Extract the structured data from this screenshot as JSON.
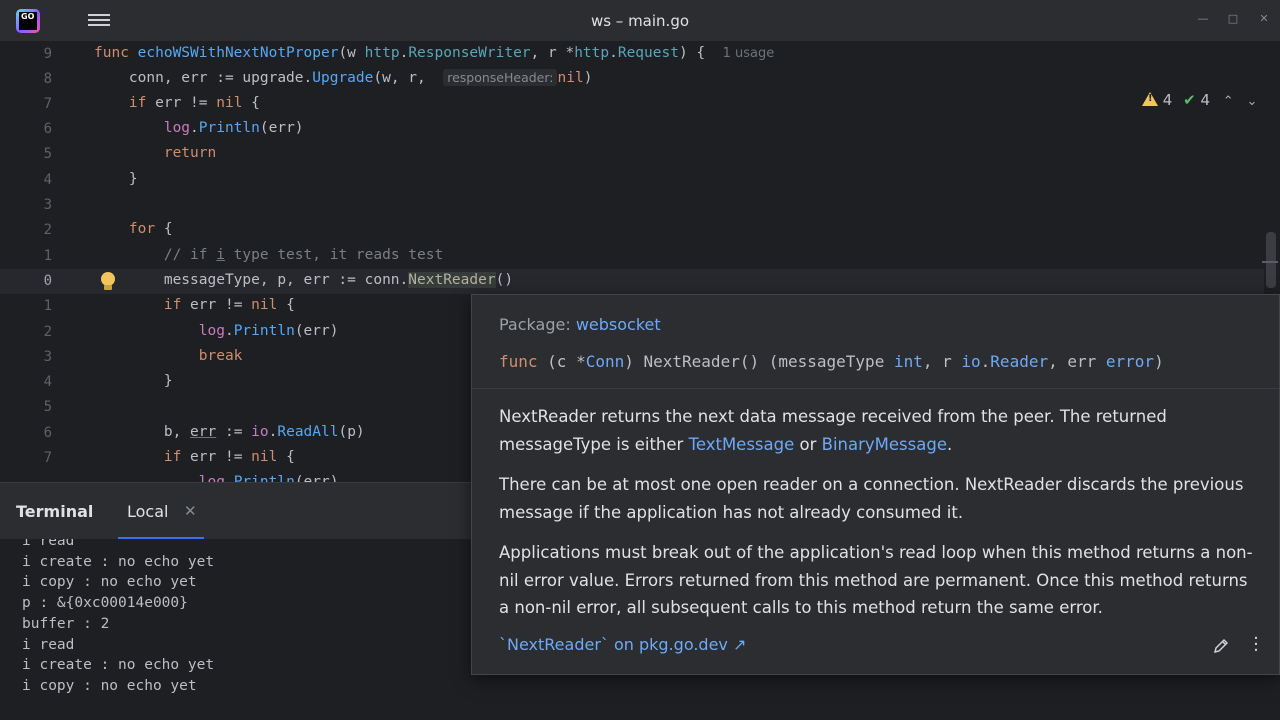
{
  "window": {
    "title": "ws – main.go",
    "logo_text": "GO"
  },
  "editor": {
    "gutter": [
      "9",
      "8",
      "7",
      "6",
      "5",
      "4",
      "3",
      "2",
      "1",
      "0",
      "1",
      "2",
      "3",
      "4",
      "5",
      "6",
      "7"
    ],
    "usage_hint": "1 usage",
    "param_hint": "responseHeader:",
    "inspections": {
      "warnings": "4",
      "weak_warnings": "4"
    }
  },
  "terminal": {
    "title": "Terminal",
    "tab_label": "Local",
    "lines": [
      "i read",
      "i create : no echo yet",
      "i copy : no echo yet",
      "p : &{0xc00014e000}",
      "buffer : 2",
      "i read",
      "i create : no echo yet",
      "i copy : no echo yet"
    ]
  },
  "doc": {
    "package_label": "Package:",
    "package_name": "websocket",
    "p1_a": "NextReader returns the next data message received from the peer. The returned messageType is either ",
    "p1_link1": "TextMessage",
    "p1_or": " or ",
    "p1_link2": "BinaryMessage",
    "p1_end": ".",
    "p2": "There can be at most one open reader on a connection. NextReader discards the previous message if the application has not already consumed it.",
    "p3": "Applications must break out of the application's read loop when this method returns a non-nil error value. Errors returned from this method are permanent. Once this method returns a non-nil error, all subsequent calls to this method return the same error.",
    "footer_link": "`NextReader` on pkg.go.dev ↗"
  },
  "colors": {
    "background": "#1e1f22",
    "panel": "#2b2d30",
    "keyword": "#cf8e6d",
    "function": "#56a8f5",
    "link": "#6ea9f7",
    "warning": "#f2c55c"
  },
  "icons": [
    "app-logo-icon",
    "hamburger-menu-icon",
    "warning-icon",
    "check-icon",
    "bulb-icon",
    "close-icon",
    "pencil-icon",
    "more-options-icon"
  ]
}
